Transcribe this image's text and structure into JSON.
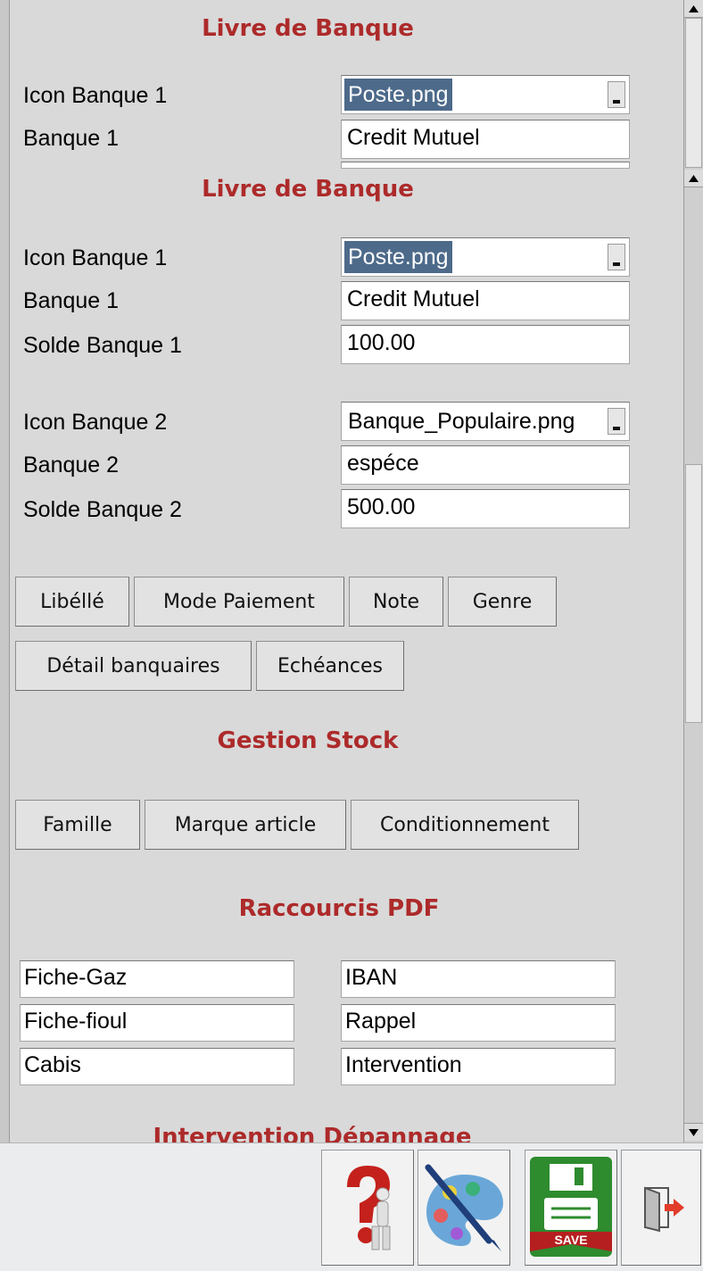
{
  "section_livre_banque": {
    "title": "Livre de Banque"
  },
  "overlay_panel": {
    "title": "Livre de Banque",
    "icon_label": "Icon Banque 1",
    "icon_value": "Poste.png",
    "bank_label": "Banque 1",
    "bank_value": "Credit Mutuel"
  },
  "bank1": {
    "icon_label": "Icon Banque 1",
    "icon_value": "Poste.png",
    "bank_label": "Banque 1",
    "bank_value": "Credit Mutuel",
    "balance_label": "Solde Banque 1",
    "balance_value": "100.00"
  },
  "bank2": {
    "icon_label": "Icon Banque 2",
    "icon_value": "Banque_Populaire.png",
    "bank_label": "Banque 2",
    "bank_value": "espéce",
    "balance_label": "Solde Banque 2",
    "balance_value": "500.00"
  },
  "bank_buttons": {
    "libelle": "Libéllé",
    "mode_paiement": "Mode Paiement",
    "note": "Note",
    "genre": "Genre",
    "detail_bancaires": "Détail banquaires",
    "echeances": "Echéances"
  },
  "stock": {
    "title": "Gestion Stock",
    "famille": "Famille",
    "marque_article": "Marque article",
    "conditionnement": "Conditionnement"
  },
  "pdf": {
    "title": "Raccourcis PDF",
    "left": [
      "Fiche-Gaz",
      "Fiche-fioul",
      "Cabis"
    ],
    "right": [
      "IBAN",
      "Rappel",
      "Intervention"
    ]
  },
  "intervention": {
    "title": "Intervention Dépannage"
  },
  "toolbar": {
    "help_icon": "help-icon",
    "palette_icon": "palette-icon",
    "save_icon": "save-icon",
    "save_label": "SAVE",
    "exit_icon": "exit-icon"
  },
  "colors": {
    "title": "#ad2a2a",
    "selection": "#4d6a8a",
    "save_green": "#2e8b2e"
  }
}
